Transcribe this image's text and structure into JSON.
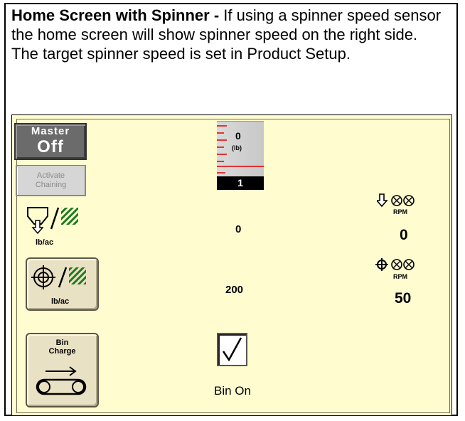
{
  "intro": {
    "heading": "Home Screen with Spinner -",
    "body": " If using a spinner speed sensor  the home screen will show spinner speed on the right side.  The target spinner speed is set in Product Setup."
  },
  "master": {
    "line1": "Master",
    "line2": "Off"
  },
  "chaining": {
    "line1": "Activate",
    "line2": "Chaining"
  },
  "actual_rate": {
    "unit": "lb/ac",
    "value": "0"
  },
  "target_rate": {
    "unit": "lb/ac",
    "value": "200"
  },
  "gauge": {
    "value": "0",
    "unit": "(lb)",
    "bar_value": "1"
  },
  "spinner_actual": {
    "unit": "RPM",
    "value": "0"
  },
  "spinner_target": {
    "unit": "RPM",
    "value": "50"
  },
  "bin_charge": {
    "line1": "Bin",
    "line2": "Charge"
  },
  "bin": {
    "checked": true,
    "label": "Bin On"
  },
  "colors": {
    "screen_bg": "#fffdd0",
    "button_bg": "#e9e1c3",
    "master_bg": "#6b6b6b",
    "gauge_tick": "#e00000",
    "stripe_green": "#1f7a1f"
  }
}
